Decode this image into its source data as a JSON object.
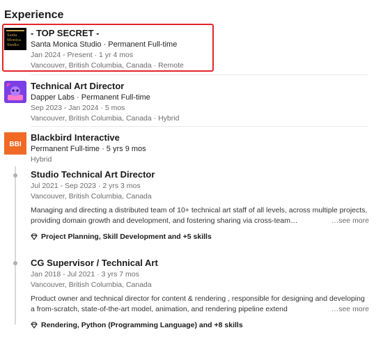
{
  "section": {
    "heading": "Experience"
  },
  "jobs": [
    {
      "title": "- TOP SECRET -",
      "company": "Santa Monica Studio · Permanent Full-time",
      "dates": "Jan 2024 - Present · 1 yr 4 mos",
      "location": "Vancouver, British Columbia, Canada · Remote",
      "logo": {
        "lines": [
          "Santa",
          "Monica",
          "Studio"
        ],
        "bg": "#000000",
        "fg": "#c8a24a"
      }
    },
    {
      "title": "Technical Art Director",
      "company": "Dapper Labs · Permanent Full-time",
      "dates": "Sep 2023 - Jan 2024 · 5 mos",
      "location": "Vancouver, British Columbia, Canada · Hybrid",
      "logo": {
        "bg": "#7b3fe4"
      }
    },
    {
      "title": "Blackbird Interactive",
      "company": "Permanent Full-time · 5 yrs 9 mos",
      "location": "Hybrid",
      "logo": {
        "text": "BBI",
        "bg": "#f06a26",
        "fg": "#ffffff"
      },
      "roles": [
        {
          "title": "Studio Technical Art Director",
          "dates": "Jul 2021 - Sep 2023 · 2 yrs 3 mos",
          "location": "Vancouver, British Columbia, Canada",
          "description": "Managing and directing a distributed team of 10+ technical art staff of all levels, across multiple projects, providing domain growth and development, and fostering sharing via cross-team…",
          "see_more": "…see more",
          "skills": "Project Planning, Skill Development and +5 skills"
        },
        {
          "title": "CG Supervisor / Technical Art",
          "dates": "Jan 2018 - Jul 2021 · 3 yrs 7 mos",
          "location": "Vancouver, British Columbia, Canada",
          "description": "Product owner and technical director for content & rendering , responsible for designing and developing a from-scratch, state-of-the-art model, animation, and rendering pipeline extend",
          "see_more": "…see more",
          "skills": "Rendering, Python (Programming Language) and +8 skills"
        }
      ]
    }
  ],
  "icons": {
    "skills": "diamond-skill-icon"
  },
  "colors": {
    "highlight": "#e3242b",
    "timeline": "#d9d9d9"
  }
}
